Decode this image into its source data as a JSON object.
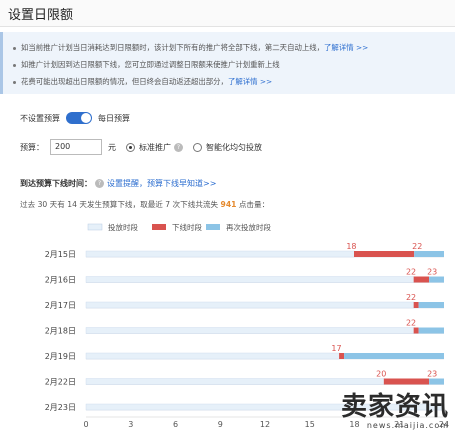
{
  "header": {
    "title": "设置日限额"
  },
  "info": {
    "line1": "如当前推广计划当日消耗达到日限额时，该计划下所有的推广将全部下线，第二天自动上线，",
    "line1_link": "了解详情 >>",
    "line2": "如推广计划因到达日限额下线，您可立即通过调整日限额来使推广计划重新上线",
    "line3": "花费可能出现超出日限额的情况，但日终会自动返还超出部分，",
    "line3_link": "了解详情 >>"
  },
  "budget_mode": {
    "off_label": "不设置预算",
    "on_label": "每日预算"
  },
  "budget": {
    "label": "预算：",
    "value": "200",
    "unit": "元",
    "option_standard": "标准推广",
    "option_smart": "智能化均匀投放"
  },
  "reach": {
    "label": "到达预算下线时间：",
    "link": "设置提醒，预算下线早知道>>",
    "summary_prefix": "过去 30 天有 14 天发生预算下线，取最近 7 次下线共流失",
    "summary_value": "941",
    "summary_suffix": "点击量："
  },
  "colors": {
    "accent": "#2f6fcd",
    "link": "#2a6ccf",
    "delivered": "#e6f0f9",
    "offline": "#d9534f",
    "redelivered": "#8cc4e6",
    "orange": "#e58a2e"
  },
  "chart_data": {
    "type": "bar",
    "orientation": "horizontal-stacked",
    "legend": [
      {
        "name": "投放时段",
        "color": "#e6f0f9"
      },
      {
        "name": "下线时段",
        "color": "#d9534f"
      },
      {
        "name": "再次投放时段",
        "color": "#8cc4e6"
      }
    ],
    "x_ticks": [
      0,
      3,
      6,
      9,
      12,
      15,
      18,
      21,
      24
    ],
    "xlim": [
      0,
      24
    ],
    "rows": [
      {
        "label": "2月15日",
        "offline_start": 18,
        "offline_end": 22,
        "redeliver_start": 22,
        "redeliver_end": 24,
        "labels": [
          "18",
          "22"
        ]
      },
      {
        "label": "2月16日",
        "offline_start": 22,
        "offline_end": 23,
        "redeliver_start": 23,
        "redeliver_end": 24,
        "labels": [
          "22",
          "23"
        ]
      },
      {
        "label": "2月17日",
        "offline_start": 22,
        "offline_end": 22.3,
        "redeliver_start": 22.3,
        "redeliver_end": 24,
        "labels": [
          "22"
        ]
      },
      {
        "label": "2月18日",
        "offline_start": 22,
        "offline_end": 22.3,
        "redeliver_start": 22.3,
        "redeliver_end": 24,
        "labels": [
          "22"
        ]
      },
      {
        "label": "2月19日",
        "offline_start": 17,
        "offline_end": 17.3,
        "redeliver_start": 17.3,
        "redeliver_end": 24,
        "labels": [
          "17"
        ]
      },
      {
        "label": "2月22日",
        "offline_start": 20,
        "offline_end": 23,
        "redeliver_start": 23,
        "redeliver_end": 24,
        "labels": [
          "20",
          "23"
        ]
      },
      {
        "label": "2月23日",
        "offline_start": null,
        "offline_end": null,
        "redeliver_start": null,
        "redeliver_end": null,
        "labels": []
      }
    ]
  },
  "watermark": {
    "cn": "卖家资讯",
    "url": "news.maijia.com"
  }
}
